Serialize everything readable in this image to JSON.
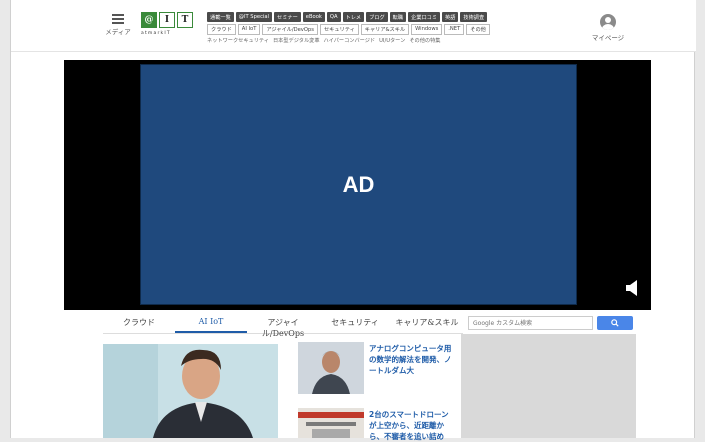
{
  "header": {
    "menu_label": "メディア",
    "logo_letters": [
      "@",
      "I",
      "T"
    ],
    "logo_sub": "atmarkIT",
    "mypage_label": "マイページ",
    "nav_primary": [
      "通載一覧",
      "@IT Special",
      "セミナー",
      "eBook",
      "QA",
      "トレメ",
      "ブログ",
      "転職",
      "企業口コミ",
      "英語",
      "技術調査"
    ],
    "nav_secondary": [
      "クラウド",
      "AI IoT",
      "アジャイル/DevOps",
      "セキュリティ",
      "キャリア&スキル",
      "Windows",
      ".NET",
      "その他"
    ],
    "nav_links": [
      "ネットワークセキュリティ",
      "日本型デジタル変革",
      "ハイパーコンバージド",
      "UI/Uターン",
      "その他の特集"
    ]
  },
  "ad": {
    "label": "AD"
  },
  "tabs": [
    {
      "label": "クラウド",
      "active": false
    },
    {
      "label": "AI IoT",
      "active": true
    },
    {
      "label": "アジャイル/DevOps",
      "active": false
    },
    {
      "label": "セキュリティ",
      "active": false
    },
    {
      "label": "キャリア&スキル",
      "active": false
    }
  ],
  "search": {
    "placeholder": "Google カスタム検索"
  },
  "articles": [
    {
      "headline": "アナログコンピュータ用の数学的解法を開発、ノートルダム大"
    },
    {
      "headline": "2台のスマートドローンが上空から、近距離から、不審者を追い詰め"
    }
  ],
  "colors": {
    "accent": "#1f5ca8",
    "ad_bg": "#1f497d",
    "logo_green": "#3a8a3a"
  }
}
